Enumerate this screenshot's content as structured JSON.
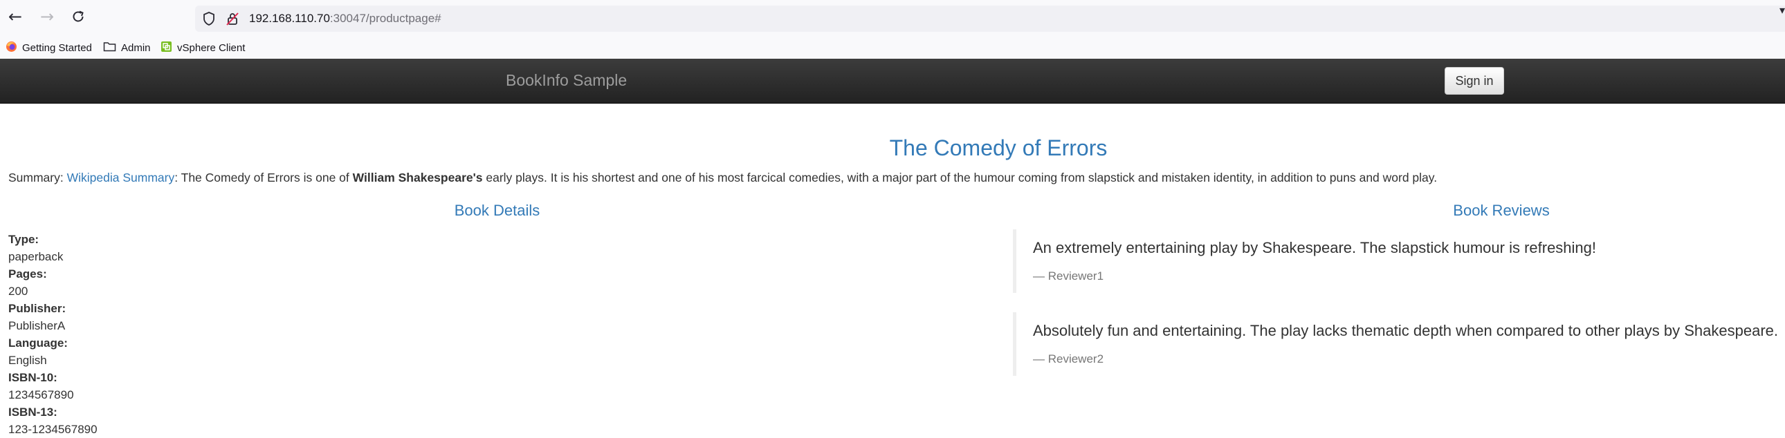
{
  "browser": {
    "url_host": "192.168.110.70",
    "url_rest": ":30047/productpage#",
    "bookmarks": [
      {
        "label": "Getting Started",
        "icon": "firefox-icon"
      },
      {
        "label": "Admin",
        "icon": "folder-icon"
      },
      {
        "label": "vSphere Client",
        "icon": "vsphere-icon"
      }
    ]
  },
  "navbar": {
    "brand": "BookInfo Sample",
    "signin_label": "Sign in"
  },
  "book": {
    "title": "The Comedy of Errors",
    "summary": {
      "prefix": "Summary: ",
      "link_text": "Wikipedia Summary",
      "text_before_bold": ": The Comedy of Errors is one of ",
      "bold_text": "William Shakespeare's",
      "text_after_bold": " early plays. It is his shortest and one of his most farcical comedies, with a major part of the humour coming from slapstick and mistaken identity, in addition to puns and word play."
    }
  },
  "details": {
    "heading": "Book Details",
    "items": [
      {
        "label": "Type:",
        "value": "paperback"
      },
      {
        "label": "Pages:",
        "value": "200"
      },
      {
        "label": "Publisher:",
        "value": "PublisherA"
      },
      {
        "label": "Language:",
        "value": "English"
      },
      {
        "label": "ISBN-10:",
        "value": "1234567890"
      },
      {
        "label": "ISBN-13:",
        "value": "123-1234567890"
      }
    ]
  },
  "reviews": {
    "heading": "Book Reviews",
    "items": [
      {
        "text": "An extremely entertaining play by Shakespeare. The slapstick humour is refreshing!",
        "author": "— Reviewer1"
      },
      {
        "text": "Absolutely fun and entertaining. The play lacks thematic depth when compared to other plays by Shakespeare.",
        "author": "— Reviewer2"
      }
    ]
  },
  "colors": {
    "link": "#337ab7",
    "navbar": "#222222",
    "text": "#333333"
  }
}
